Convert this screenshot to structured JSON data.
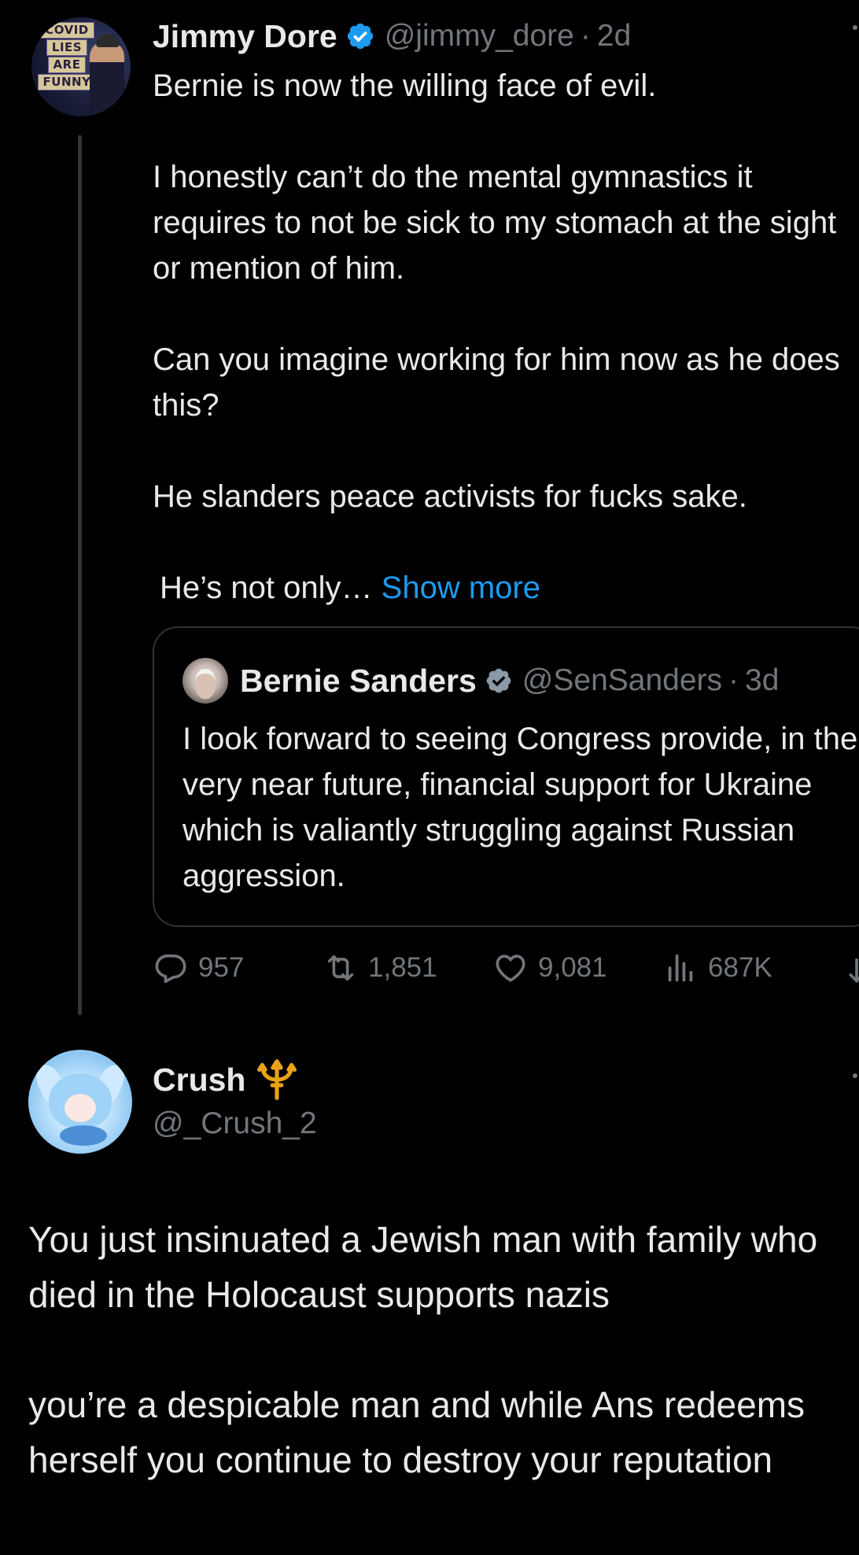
{
  "colors": {
    "background": "#000000",
    "text": "#e7e9ea",
    "secondary": "#71767b",
    "link": "#1d9bf0",
    "verified": "#1d9bf0",
    "border": "#2f3336"
  },
  "tweet": {
    "avatar_text": [
      "COVID",
      "LIES",
      "ARE",
      "FUNNY"
    ],
    "author_name": "Jimmy Dore",
    "verified_icon": "verified-badge-icon",
    "handle": "@jimmy_dore",
    "separator": "·",
    "time": "2d",
    "body": [
      "Bernie is now the willing face of evil.",
      "I honestly can’t do the mental gymnastics it requires to not be sick to my stomach at the sight or mention of him.",
      "Can you imagine working for him now as he does this?",
      "He slanders peace activists for fucks sake."
    ],
    "truncated_text": "He’s  not only…",
    "show_more": "Show more",
    "quote": {
      "author_name": "Bernie Sanders",
      "handle": "@SenSanders",
      "separator": "·",
      "time": "3d",
      "body": "I look forward to seeing Congress provide, in the very near future, financial support for Ukraine which is valiantly struggling against Russian aggression."
    },
    "actions": {
      "replies": "957",
      "reposts": "1,851",
      "likes": "9,081",
      "views": "687K",
      "icons": [
        "reply-icon",
        "repost-icon",
        "like-icon",
        "views-icon",
        "share-icon"
      ]
    }
  },
  "reply": {
    "author_name": "Crush",
    "name_emoji": "trident-emoji",
    "handle": "@_Crush_2",
    "body": [
      "You just insinuated a Jewish man with family who died in the Holocaust supports nazis",
      "you’re a despicable man and while Ans redeems herself you continue to destroy your reputation"
    ]
  }
}
